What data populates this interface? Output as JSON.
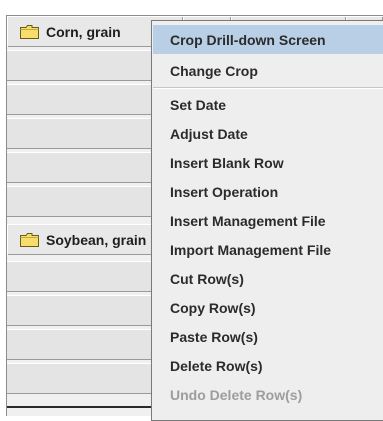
{
  "crop_table": {
    "crops": [
      {
        "label": "Corn, grain",
        "icon": "folder-icon"
      },
      {
        "label": "Soybean, grain",
        "icon": "folder-icon"
      }
    ]
  },
  "context_menu": {
    "items": [
      {
        "label": "Crop Drill-down Screen",
        "state": "highlighted"
      },
      {
        "label": "Change Crop",
        "state": "enabled"
      },
      {
        "label": "Set Date",
        "state": "enabled"
      },
      {
        "label": "Adjust Date",
        "state": "enabled"
      },
      {
        "label": "Insert Blank Row",
        "state": "enabled"
      },
      {
        "label": "Insert Operation",
        "state": "enabled"
      },
      {
        "label": "Insert Management File",
        "state": "enabled"
      },
      {
        "label": "Import Management File",
        "state": "enabled"
      },
      {
        "label": "Cut Row(s)",
        "state": "enabled"
      },
      {
        "label": "Copy Row(s)",
        "state": "enabled"
      },
      {
        "label": "Paste Row(s)",
        "state": "enabled"
      },
      {
        "label": "Delete Row(s)",
        "state": "enabled"
      },
      {
        "label": "Undo Delete Row(s)",
        "state": "disabled"
      }
    ]
  },
  "colors": {
    "menu_highlight": "#b8cfe5",
    "folder_fill": "#f6dd6c",
    "disabled_text": "#9d9d9d"
  }
}
